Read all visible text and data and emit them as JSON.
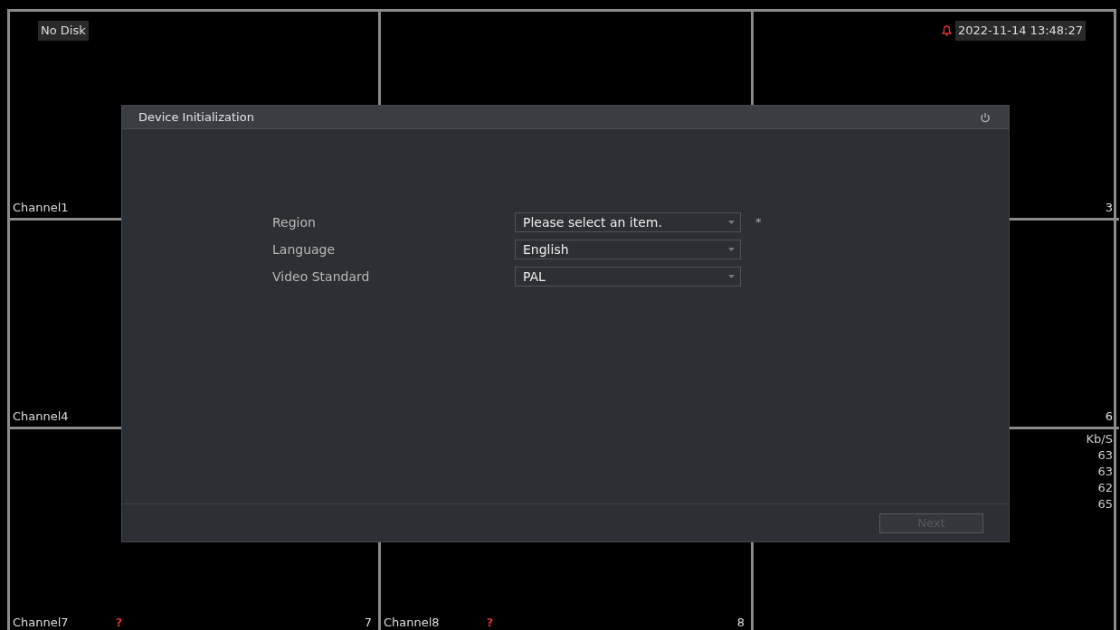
{
  "tile_rows": [
    {
      "left": {
        "top_left": "No Disk",
        "channel": "Channel1"
      },
      "right": {
        "alarm": true,
        "datetime": "2022-11-14 13:48:27",
        "number": "3"
      }
    },
    {
      "left": {
        "channel": "Channel4"
      },
      "right": {
        "number": "6"
      }
    },
    {
      "left": {
        "channel": "Channel7",
        "flag": "?",
        "number": "7"
      },
      "center": {
        "channel": "Channel8",
        "flag": "?",
        "number": "8"
      },
      "right": {
        "bitrate": {
          "unit": "Kb/S",
          "values": [
            "63",
            "63",
            "62",
            "65"
          ]
        }
      }
    }
  ],
  "dialog": {
    "title": "Device Initialization",
    "fields": [
      {
        "label": "Region",
        "placeholder": "Please select an item.",
        "required_mark": "*"
      },
      {
        "label": "Language",
        "value": "English"
      },
      {
        "label": "Video Standard",
        "value": "PAL"
      }
    ],
    "next_button": {
      "label": "Next",
      "disabled": true
    }
  }
}
